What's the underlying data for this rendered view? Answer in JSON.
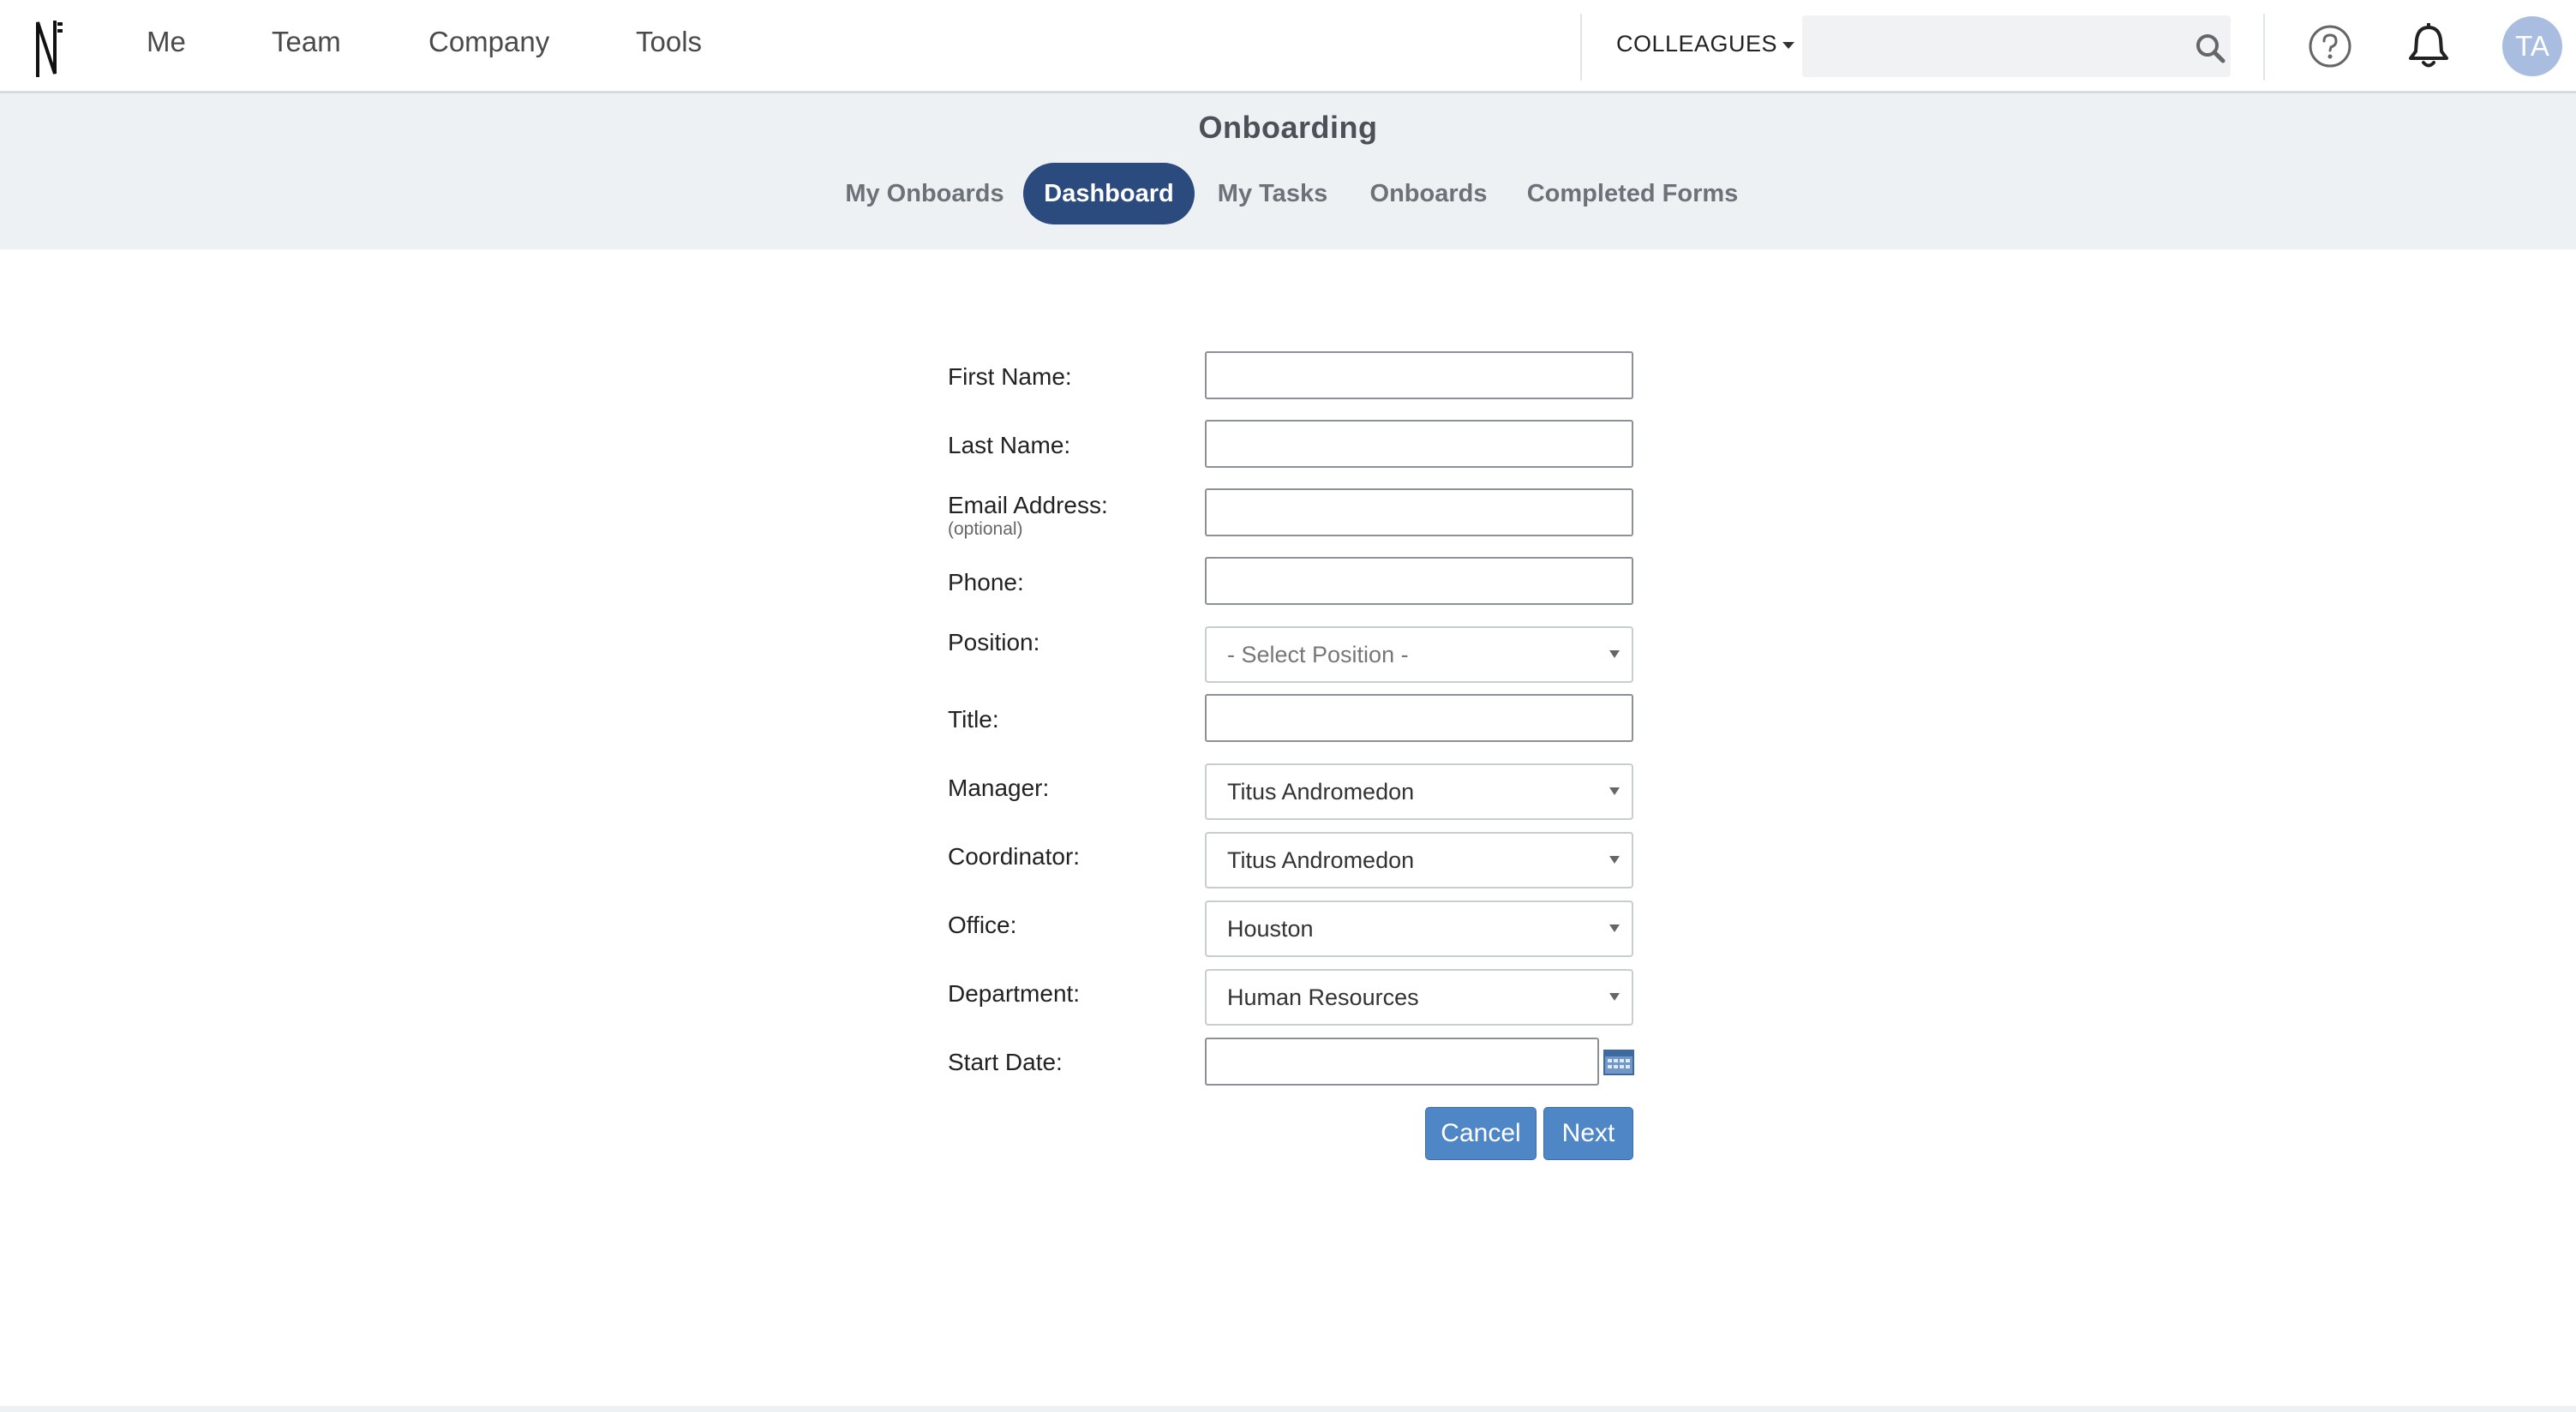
{
  "topnav": {
    "items": [
      "Me",
      "Team",
      "Company",
      "Tools"
    ],
    "colleagues_label": "COLLEAGUES",
    "search_placeholder": "",
    "avatar_initials": "TA"
  },
  "subheader": {
    "title": "Onboarding",
    "tabs": [
      {
        "label": "My Onboards",
        "active": false
      },
      {
        "label": "Dashboard",
        "active": true
      },
      {
        "label": "My Tasks",
        "active": false
      },
      {
        "label": "Onboards",
        "active": false
      },
      {
        "label": "Completed Forms",
        "active": false
      }
    ]
  },
  "form": {
    "first_name": {
      "label": "First Name:",
      "value": ""
    },
    "last_name": {
      "label": "Last Name:",
      "value": ""
    },
    "email": {
      "label": "Email Address:",
      "sublabel": "(optional)",
      "value": ""
    },
    "phone": {
      "label": "Phone:",
      "value": ""
    },
    "position": {
      "label": "Position:",
      "value": "- Select Position -"
    },
    "title": {
      "label": "Title:",
      "value": ""
    },
    "manager": {
      "label": "Manager:",
      "value": "Titus Andromedon"
    },
    "coordinator": {
      "label": "Coordinator:",
      "value": "Titus Andromedon"
    },
    "office": {
      "label": "Office:",
      "value": "Houston"
    },
    "department": {
      "label": "Department:",
      "value": "Human Resources"
    },
    "start_date": {
      "label": "Start Date:",
      "value": ""
    },
    "cancel_label": "Cancel",
    "next_label": "Next"
  },
  "colors": {
    "active_tab": "#2b4a7e",
    "button": "#4f86c6",
    "subheader_bg": "#eef1f4",
    "avatar_bg": "#a8bde0"
  }
}
